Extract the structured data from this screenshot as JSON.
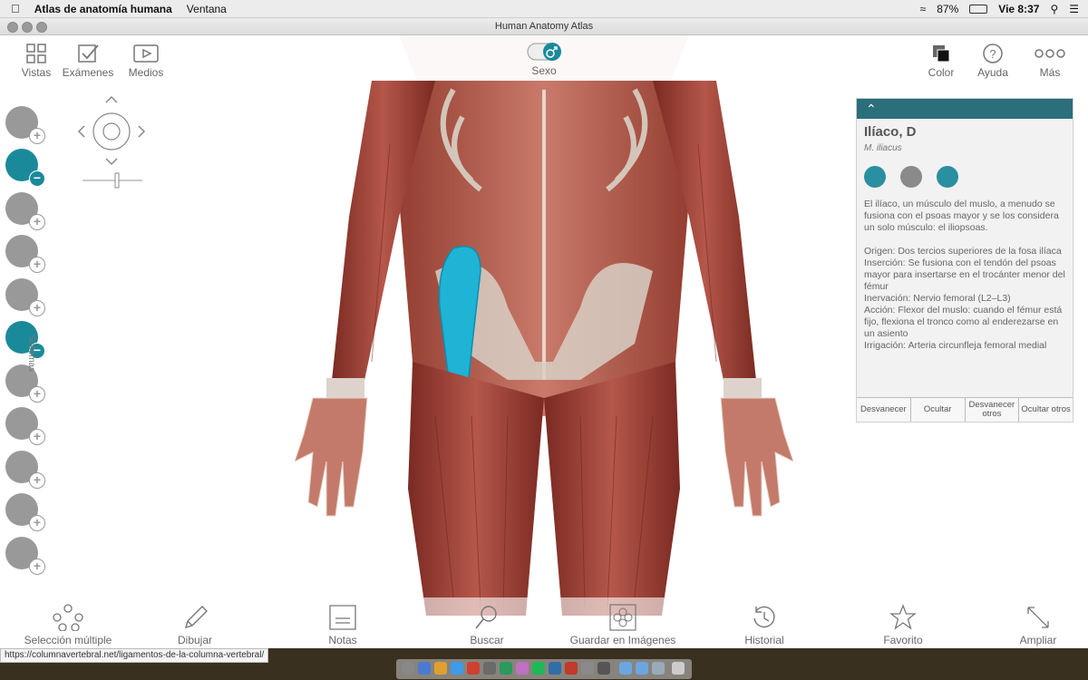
{
  "menubar": {
    "app_name": "Atlas de anatomía humana",
    "menu": "Ventana",
    "battery": "87%",
    "clock": "Vie 8:37"
  },
  "window": {
    "title": "Human Anatomy Atlas"
  },
  "toolbar": {
    "vistas": "Vistas",
    "examenes": "Exámenes",
    "medios": "Medios",
    "sexo": "Sexo",
    "color": "Color",
    "ayuda": "Ayuda",
    "mas": "Más"
  },
  "systems_label": "Sistemas",
  "panel": {
    "title": "Ilíaco, D",
    "latin": "M. iliacus",
    "description": "El ilíaco, un músculo del muslo, a menudo se fusiona con el psoas mayor y se los considera un solo músculo: el iliopsoas.",
    "origen": "Origen: Dos tercios superiores de la fosa ilíaca",
    "insercion": "Inserción: Se fusiona con el tendón del psoas mayor para insertarse en el trocánter menor del fémur",
    "inervacion": "Inervación: Nervio femoral (L2–L3)",
    "accion": "Acción: Flexor del muslo: cuando el fémur está fijo, flexiona el tronco como al enderezarse en un asiento",
    "irrigacion": "Irrigación: Arteria circunfleja femoral medial",
    "btn_desvanecer": "Desvanecer",
    "btn_ocultar": "Ocultar",
    "btn_desvanecer_otros": "Desvanecer otros",
    "btn_ocultar_otros": "Ocultar otros"
  },
  "bottombar": {
    "seleccion": "Selección múltiple",
    "dibujar": "Dibujar",
    "notas": "Notas",
    "buscar": "Buscar",
    "guardar": "Guardar en Imágenes",
    "historial": "Historial",
    "favorito": "Favorito",
    "ampliar": "Ampliar"
  },
  "browser": {
    "url": "https://columnavertebral.net/ligamentos-de-la-columna-vertebral/"
  },
  "colors": {
    "accent": "#1a8a9a",
    "muscle": "#a8463a",
    "highlight": "#1fb3d6"
  }
}
